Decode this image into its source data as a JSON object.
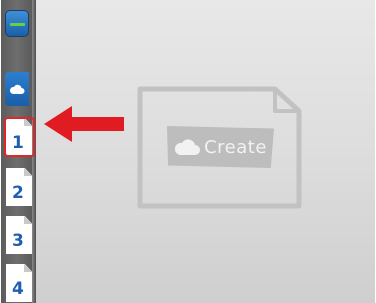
{
  "pages": [
    {
      "label": "1"
    },
    {
      "label": "2"
    },
    {
      "label": "3"
    },
    {
      "label": "4"
    }
  ],
  "create": {
    "label": "Create"
  },
  "colors": {
    "accent_blue": "#1f5fb0",
    "highlight_red": "#e0262b",
    "placeholder_gray": "#bdbdbd"
  },
  "icons": {
    "top_button": "minus-bar-icon",
    "cloud_button": "cloud-icon",
    "pointer": "arrow-left-icon"
  }
}
